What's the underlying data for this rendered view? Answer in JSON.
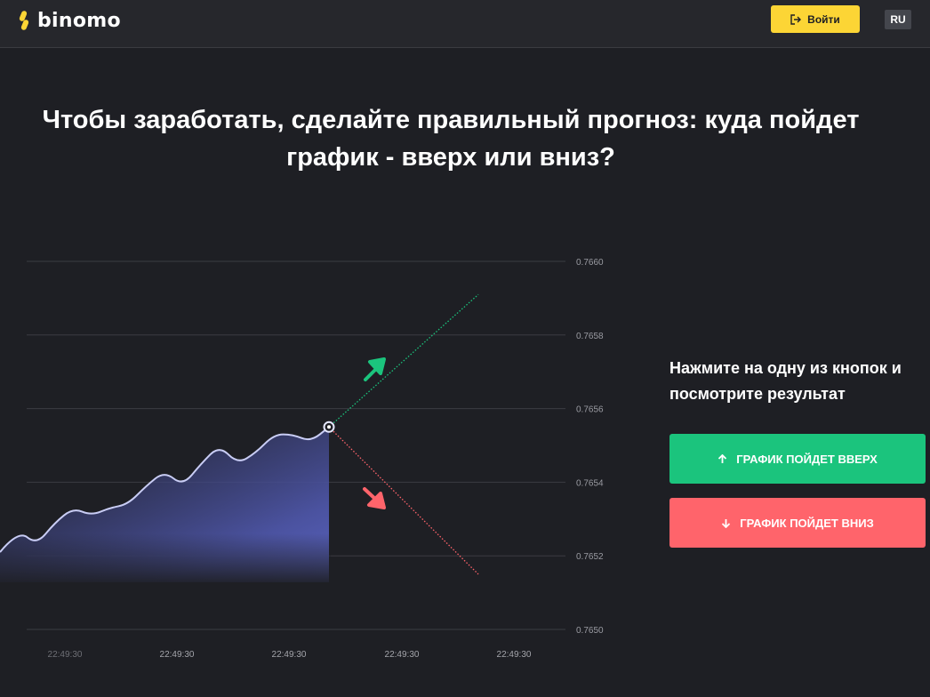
{
  "header": {
    "logo_text": "binomo",
    "login_label": "Войти",
    "lang_label": "RU"
  },
  "headline": "Чтобы заработать, сделайте правильный прогноз: куда пойдет график - вверх или вниз?",
  "panel": {
    "instruction": "Нажмите на одну из кнопок и посмотрите результат",
    "up_label": "ГРАФИК ПОЙДЕТ ВВЕРХ",
    "down_label": "ГРАФИК ПОЙДЕТ ВНИЗ"
  },
  "colors": {
    "brand_yellow": "#fcd535",
    "up_green": "#1bc47d",
    "down_red": "#ff646b",
    "background": "#1e1f24",
    "line": "#c9cdf5"
  },
  "chart_data": {
    "type": "line",
    "y_ticks": [
      "0.7660",
      "0.7658",
      "0.7656",
      "0.7654",
      "0.7652",
      "0.7650"
    ],
    "ylim": [
      0.765,
      0.766
    ],
    "x_ticks": [
      "22:49:30",
      "22:49:30",
      "22:49:30",
      "22:49:30",
      "22:49:30"
    ],
    "series": [
      {
        "values": [
          0.76521,
          0.76527,
          0.76523,
          0.76529,
          0.76533,
          0.76531,
          0.76533,
          0.76534,
          0.76539,
          0.76543,
          0.76539,
          0.76545,
          0.7655,
          0.76545,
          0.76548,
          0.76553,
          0.76553,
          0.76551,
          0.76555
        ]
      }
    ],
    "prediction_up_end": 0.76591,
    "prediction_down_end": 0.76515
  }
}
